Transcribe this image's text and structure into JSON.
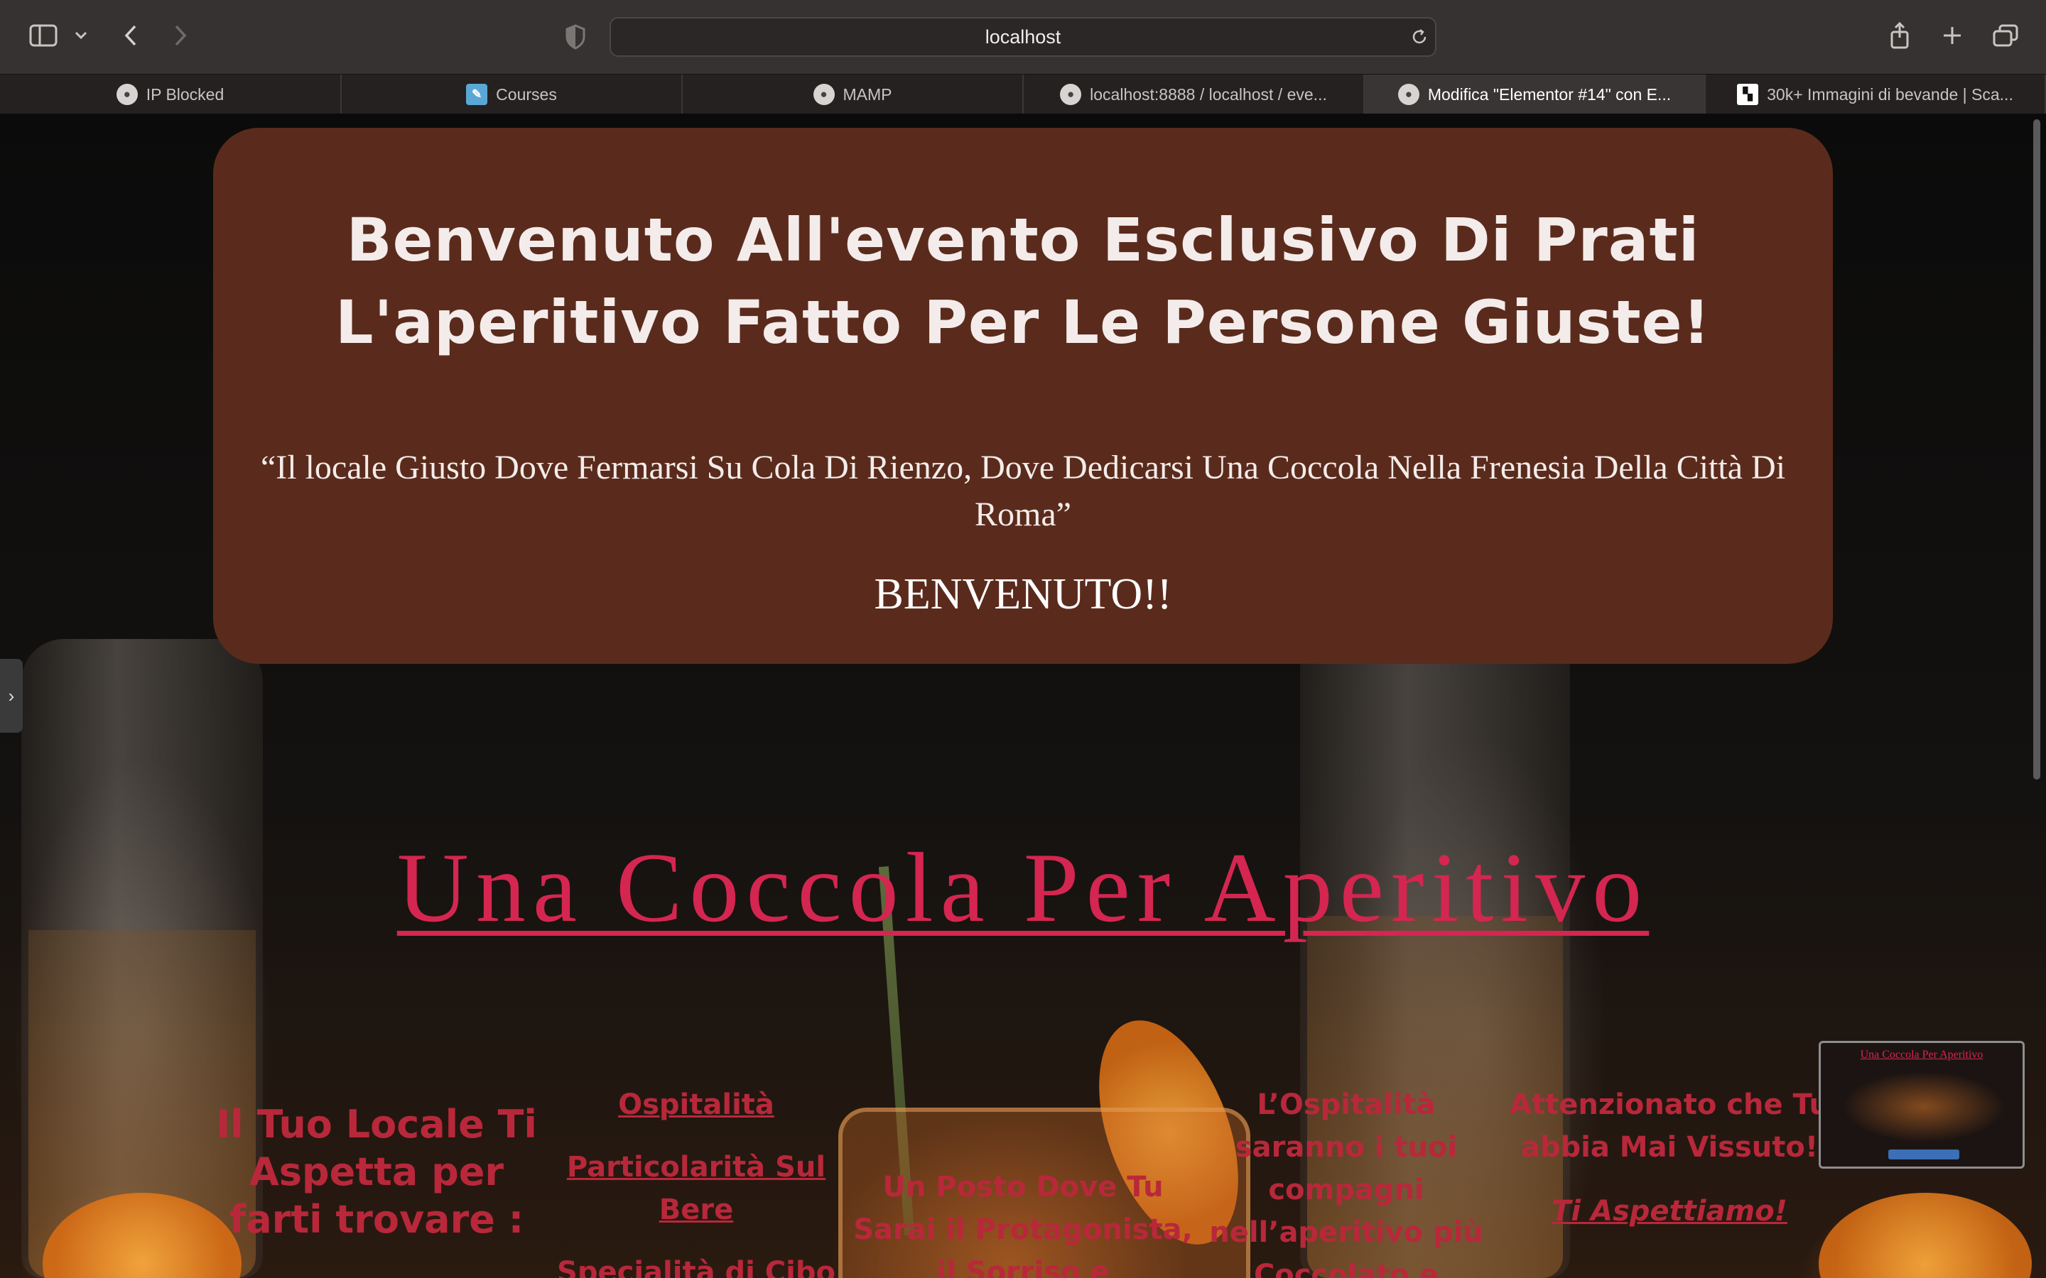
{
  "browser": {
    "url": "localhost",
    "tabs": [
      {
        "label": "IP Blocked",
        "icon": "mamp-favicon-icon"
      },
      {
        "label": "Courses",
        "icon": "courses-favicon-icon"
      },
      {
        "label": "MAMP",
        "icon": "mamp-favicon-icon"
      },
      {
        "label": "localhost:8888 / localhost / eve...",
        "icon": "mamp-favicon-icon"
      },
      {
        "label": "Modifica \"Elementor #14\" con E...",
        "icon": "mamp-favicon-icon",
        "active": true
      },
      {
        "label": "30k+ Immagini di bevande | Sca...",
        "icon": "checker-favicon-icon"
      }
    ]
  },
  "hero": {
    "title_line1": "Benvenuto All'evento Esclusivo Di Prati",
    "title_line2": "L'aperitivo Fatto Per Le Persone Giuste!",
    "quote": "“Il locale Giusto Dove Fermarsi Su Cola Di Rienzo, Dove Dedicarsi Una Coccola Nella Frenesia Della Città Di Roma”",
    "welcome": "BENVENUTO!!"
  },
  "section": {
    "heading": "Una Coccola Per Aperitivo"
  },
  "columns": {
    "col1": "Il Tuo Locale Ti Aspetta per farti trovare :",
    "col2_links": [
      "Ospitalità",
      "Particolarità Sul Bere ",
      "Specialità di Cibo "
    ],
    "col3": "Un Posto Dove Tu Sarai il Protagonista, il Sorriso e",
    "col4": "L’Ospitalità saranno i tuoi compagni nell’aperitivo più Coccolato e",
    "col5": "Attenzionato che Tu abbia Mai Vissuto!",
    "col5_cta": "Ti Aspettiamo!"
  },
  "pip": {
    "title": "Una Coccola Per Aperitivo"
  },
  "colors": {
    "chrome": "#353231",
    "hero_card": "#5a2b1c",
    "heading_accent": "#d42650",
    "column_text": "#b8283a"
  }
}
